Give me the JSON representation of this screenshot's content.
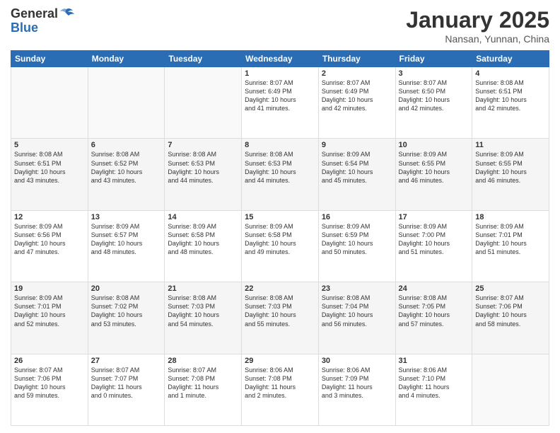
{
  "header": {
    "logo_general": "General",
    "logo_blue": "Blue",
    "month": "January 2025",
    "location": "Nansan, Yunnan, China"
  },
  "days_of_week": [
    "Sunday",
    "Monday",
    "Tuesday",
    "Wednesday",
    "Thursday",
    "Friday",
    "Saturday"
  ],
  "weeks": [
    [
      {
        "day": "",
        "info": ""
      },
      {
        "day": "",
        "info": ""
      },
      {
        "day": "",
        "info": ""
      },
      {
        "day": "1",
        "info": "Sunrise: 8:07 AM\nSunset: 6:49 PM\nDaylight: 10 hours\nand 41 minutes."
      },
      {
        "day": "2",
        "info": "Sunrise: 8:07 AM\nSunset: 6:49 PM\nDaylight: 10 hours\nand 42 minutes."
      },
      {
        "day": "3",
        "info": "Sunrise: 8:07 AM\nSunset: 6:50 PM\nDaylight: 10 hours\nand 42 minutes."
      },
      {
        "day": "4",
        "info": "Sunrise: 8:08 AM\nSunset: 6:51 PM\nDaylight: 10 hours\nand 42 minutes."
      }
    ],
    [
      {
        "day": "5",
        "info": "Sunrise: 8:08 AM\nSunset: 6:51 PM\nDaylight: 10 hours\nand 43 minutes."
      },
      {
        "day": "6",
        "info": "Sunrise: 8:08 AM\nSunset: 6:52 PM\nDaylight: 10 hours\nand 43 minutes."
      },
      {
        "day": "7",
        "info": "Sunrise: 8:08 AM\nSunset: 6:53 PM\nDaylight: 10 hours\nand 44 minutes."
      },
      {
        "day": "8",
        "info": "Sunrise: 8:08 AM\nSunset: 6:53 PM\nDaylight: 10 hours\nand 44 minutes."
      },
      {
        "day": "9",
        "info": "Sunrise: 8:09 AM\nSunset: 6:54 PM\nDaylight: 10 hours\nand 45 minutes."
      },
      {
        "day": "10",
        "info": "Sunrise: 8:09 AM\nSunset: 6:55 PM\nDaylight: 10 hours\nand 46 minutes."
      },
      {
        "day": "11",
        "info": "Sunrise: 8:09 AM\nSunset: 6:55 PM\nDaylight: 10 hours\nand 46 minutes."
      }
    ],
    [
      {
        "day": "12",
        "info": "Sunrise: 8:09 AM\nSunset: 6:56 PM\nDaylight: 10 hours\nand 47 minutes."
      },
      {
        "day": "13",
        "info": "Sunrise: 8:09 AM\nSunset: 6:57 PM\nDaylight: 10 hours\nand 48 minutes."
      },
      {
        "day": "14",
        "info": "Sunrise: 8:09 AM\nSunset: 6:58 PM\nDaylight: 10 hours\nand 48 minutes."
      },
      {
        "day": "15",
        "info": "Sunrise: 8:09 AM\nSunset: 6:58 PM\nDaylight: 10 hours\nand 49 minutes."
      },
      {
        "day": "16",
        "info": "Sunrise: 8:09 AM\nSunset: 6:59 PM\nDaylight: 10 hours\nand 50 minutes."
      },
      {
        "day": "17",
        "info": "Sunrise: 8:09 AM\nSunset: 7:00 PM\nDaylight: 10 hours\nand 51 minutes."
      },
      {
        "day": "18",
        "info": "Sunrise: 8:09 AM\nSunset: 7:01 PM\nDaylight: 10 hours\nand 51 minutes."
      }
    ],
    [
      {
        "day": "19",
        "info": "Sunrise: 8:09 AM\nSunset: 7:01 PM\nDaylight: 10 hours\nand 52 minutes."
      },
      {
        "day": "20",
        "info": "Sunrise: 8:08 AM\nSunset: 7:02 PM\nDaylight: 10 hours\nand 53 minutes."
      },
      {
        "day": "21",
        "info": "Sunrise: 8:08 AM\nSunset: 7:03 PM\nDaylight: 10 hours\nand 54 minutes."
      },
      {
        "day": "22",
        "info": "Sunrise: 8:08 AM\nSunset: 7:03 PM\nDaylight: 10 hours\nand 55 minutes."
      },
      {
        "day": "23",
        "info": "Sunrise: 8:08 AM\nSunset: 7:04 PM\nDaylight: 10 hours\nand 56 minutes."
      },
      {
        "day": "24",
        "info": "Sunrise: 8:08 AM\nSunset: 7:05 PM\nDaylight: 10 hours\nand 57 minutes."
      },
      {
        "day": "25",
        "info": "Sunrise: 8:07 AM\nSunset: 7:06 PM\nDaylight: 10 hours\nand 58 minutes."
      }
    ],
    [
      {
        "day": "26",
        "info": "Sunrise: 8:07 AM\nSunset: 7:06 PM\nDaylight: 10 hours\nand 59 minutes."
      },
      {
        "day": "27",
        "info": "Sunrise: 8:07 AM\nSunset: 7:07 PM\nDaylight: 11 hours\nand 0 minutes."
      },
      {
        "day": "28",
        "info": "Sunrise: 8:07 AM\nSunset: 7:08 PM\nDaylight: 11 hours\nand 1 minute."
      },
      {
        "day": "29",
        "info": "Sunrise: 8:06 AM\nSunset: 7:08 PM\nDaylight: 11 hours\nand 2 minutes."
      },
      {
        "day": "30",
        "info": "Sunrise: 8:06 AM\nSunset: 7:09 PM\nDaylight: 11 hours\nand 3 minutes."
      },
      {
        "day": "31",
        "info": "Sunrise: 8:06 AM\nSunset: 7:10 PM\nDaylight: 11 hours\nand 4 minutes."
      },
      {
        "day": "",
        "info": ""
      }
    ]
  ]
}
